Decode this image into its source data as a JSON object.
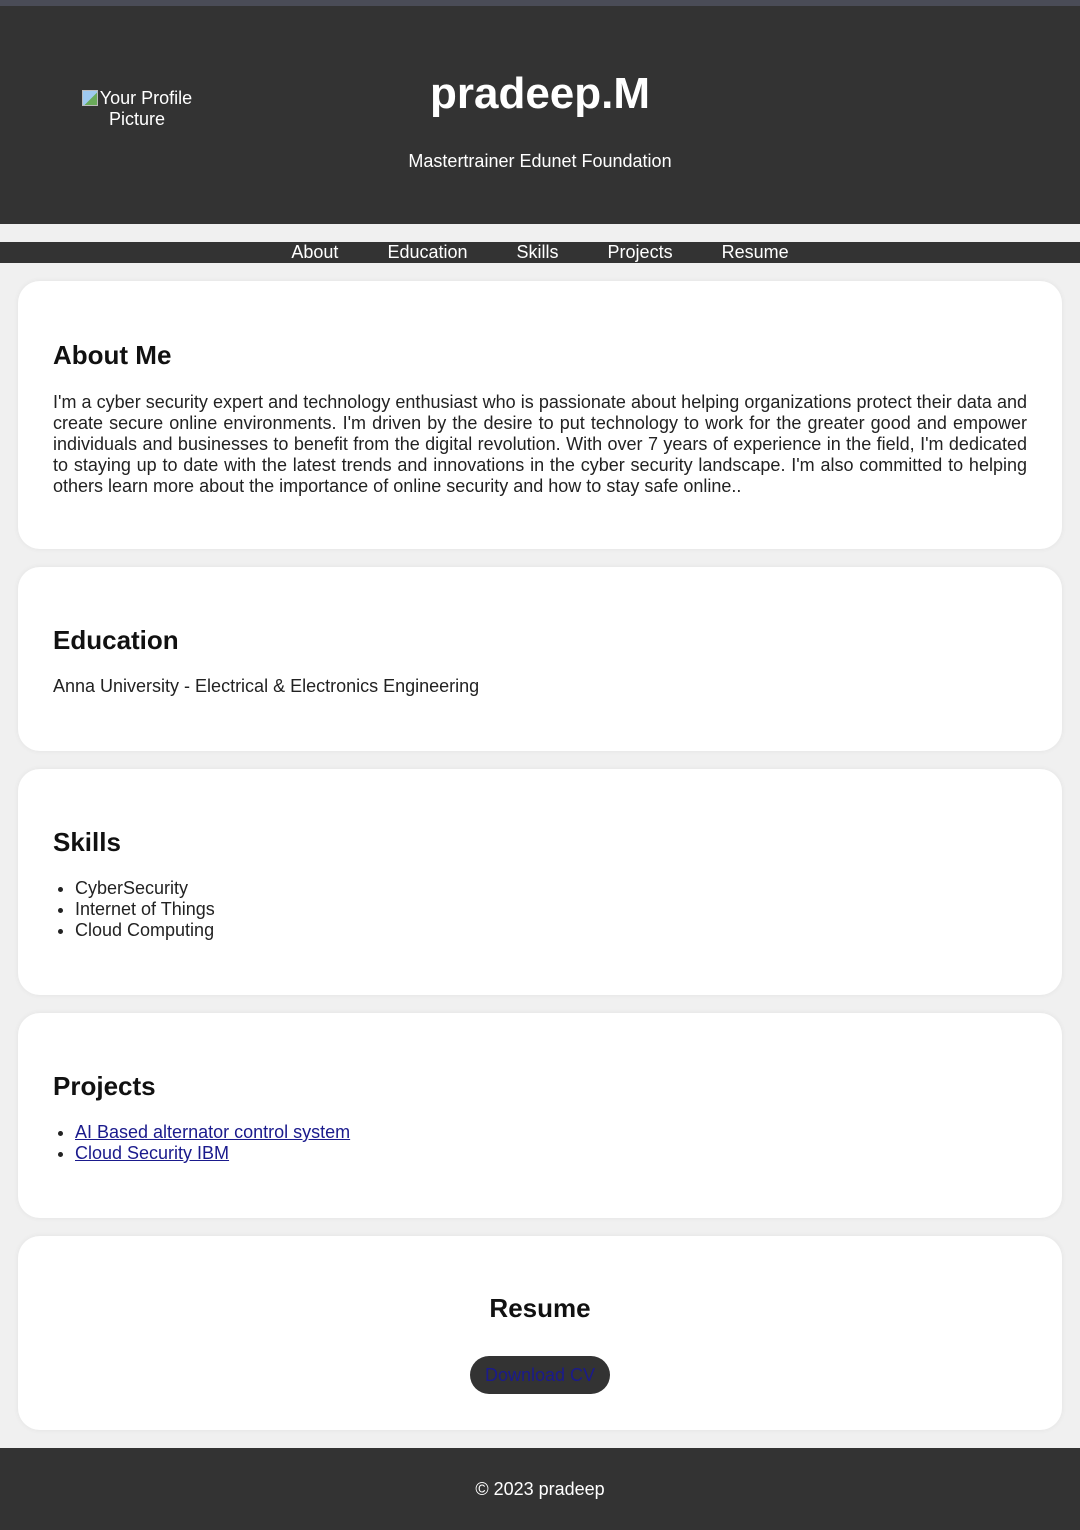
{
  "header": {
    "profile_alt": "Your Profile Picture",
    "name": "pradeep.M",
    "subtitle": "Mastertrainer Edunet Foundation"
  },
  "nav": {
    "items": [
      "About",
      "Education",
      "Skills",
      "Projects",
      "Resume"
    ]
  },
  "about": {
    "title": "About Me",
    "text": "I'm a cyber security expert and technology enthusiast who is passionate about helping organizations protect their data and create secure online environments. I'm driven by the desire to put technology to work for the greater good and empower individuals and businesses to benefit from the digital revolution. With over 7 years of experience in the field, I'm dedicated to staying up to date with the latest trends and innovations in the cyber security landscape. I'm also committed to helping others learn more about the importance of online security and how to stay safe online.."
  },
  "education": {
    "title": "Education",
    "text": "Anna University - Electrical & Electronics Engineering"
  },
  "skills": {
    "title": "Skills",
    "items": [
      "CyberSecurity",
      "Internet of Things",
      "Cloud Computing"
    ]
  },
  "projects": {
    "title": "Projects",
    "items": [
      "AI Based alternator control system",
      "Cloud Security IBM"
    ]
  },
  "resume": {
    "title": "Resume",
    "button": "Download CV"
  },
  "footer": {
    "text": "© 2023 pradeep"
  },
  "colors": {
    "header_bg": "#333333",
    "page_bg": "#f0f0f0",
    "card_bg": "#ffffff",
    "link": "#1a1a8c"
  }
}
